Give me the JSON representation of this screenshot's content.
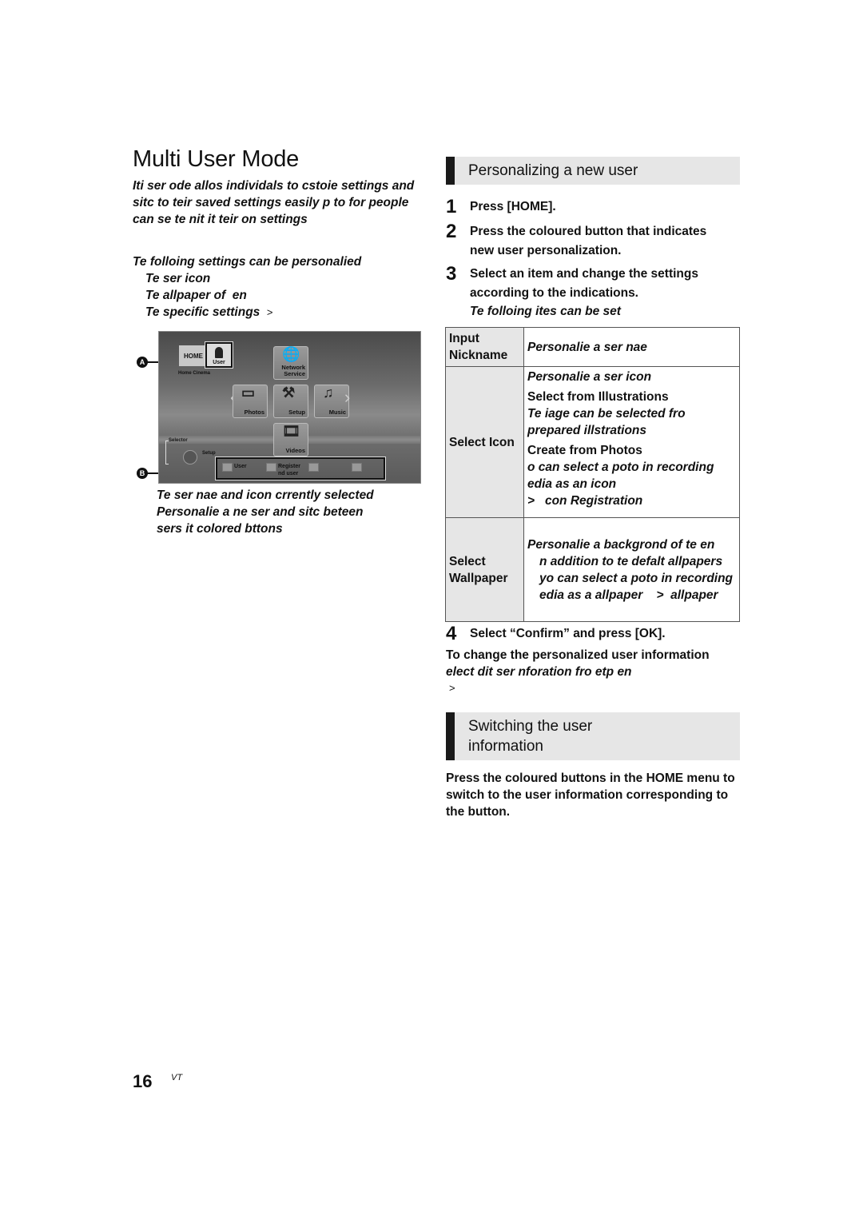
{
  "page": {
    "title": "Multi User Mode",
    "intro": "Iti ser ode allos individals to cstoie settings and sitc to teir saved settings easily p to for people can se te nit it teir on settings",
    "settings_heading": "Te folloing settings can be personalied",
    "settings_items": [
      "Te ser icon",
      "Te allpaper of  en",
      "Te specific settings"
    ],
    "settings_item_arrow": ">",
    "screen": {
      "home_label": "HOME",
      "user_label": "User",
      "device_name": "Home Cinema",
      "tiles": [
        {
          "label": "Network Service",
          "icon": "globe-icon"
        },
        {
          "label": "Photos",
          "icon": "photos-icon"
        },
        {
          "label": "Setup",
          "icon": "setup-icon"
        },
        {
          "label": "Music",
          "icon": "music-icon"
        },
        {
          "label": "Videos",
          "icon": "film-icon"
        }
      ],
      "selector_label": "Selector",
      "setup_hint": "Setup",
      "color_buttons": [
        {
          "label": "User"
        },
        {
          "label": "Register nd user"
        },
        {
          "label": ""
        },
        {
          "label": ""
        }
      ],
      "callout_a": "A",
      "callout_b": "B"
    },
    "caption_lines": [
      "Te ser nae and icon crrently selected",
      "Personalie a ne ser and sitc beteen",
      "sers it colored bttons"
    ],
    "page_number": "16",
    "page_code": "VT"
  },
  "personalizing": {
    "heading": "Personalizing a new user",
    "steps": [
      {
        "num": "1",
        "text": "Press [HOME]."
      },
      {
        "num": "2",
        "text": "Press the coloured button that indicates new user personalization."
      },
      {
        "num": "3",
        "text": "Select an item and change the settings according to the indications.",
        "note": "Te folloing ites can be set"
      }
    ],
    "table": [
      {
        "key": "Input Nickname",
        "lines": [
          {
            "t": "Personalie a ser nae",
            "s": "bi"
          }
        ]
      },
      {
        "key": "Select Icon",
        "lines": [
          {
            "t": "Personalie a ser icon",
            "s": "bi"
          },
          {
            "t": "Select from Illustrations",
            "s": "b"
          },
          {
            "t": "Te iage can be selected fro prepared illstrations",
            "s": "bi"
          },
          {
            "t": "Create from Photos",
            "s": "b"
          },
          {
            "t": "o can select a poto in recording edia as an icon",
            "s": "bi"
          },
          {
            "t": ">   con Registration",
            "s": "bi"
          }
        ]
      },
      {
        "key": "Select Wallpaper",
        "lines": [
          {
            "t": "Personalie a backgrond of te  en",
            "s": "bi"
          },
          {
            "t": "n addition to te defalt allpapers yo can select a poto in recording edia as a allpaper    >  allpaper",
            "s": "bi ind"
          }
        ]
      }
    ],
    "step4": {
      "num": "4",
      "text": "Select “Confirm” and press [OK]."
    },
    "change_note_heading": "To change the personalized user information",
    "change_note_text": "elect dit ser nforation fro etp en",
    "change_note_arrow": ">"
  },
  "switching": {
    "heading_line1": "Switching the user",
    "heading_line2": "information",
    "body": "Press the coloured buttons in the HOME menu to switch to the user information corresponding to the button."
  }
}
